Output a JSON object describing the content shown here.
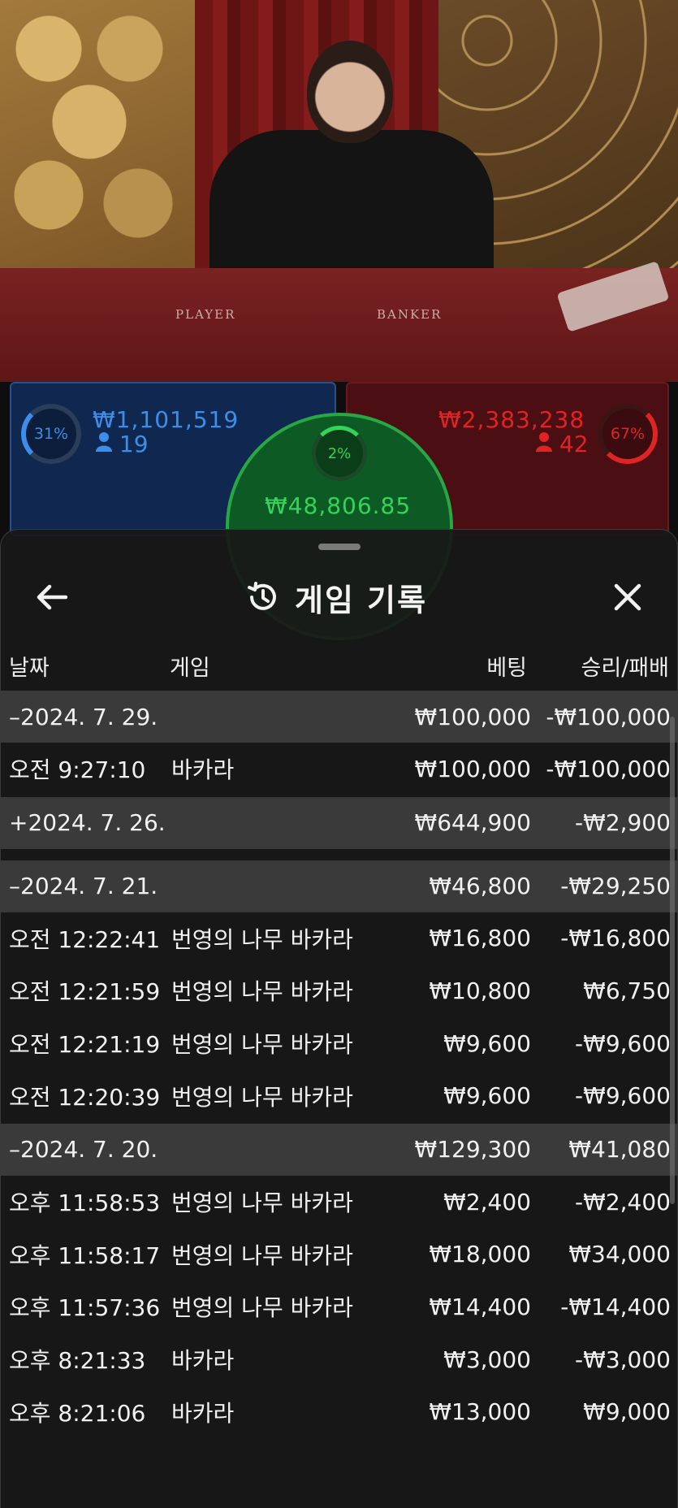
{
  "video": {
    "felt_player": "PLAYER",
    "felt_banker": "BANKER"
  },
  "bets": {
    "player": {
      "percent": "31%",
      "amount": "₩1,101,519",
      "count": "19",
      "color": "#3b8eea"
    },
    "banker": {
      "percent": "67%",
      "amount": "₩2,383,238",
      "count": "42",
      "color": "#e02323"
    },
    "tie": {
      "percent": "2%",
      "amount": "₩48,806.85",
      "color": "#33d45a"
    }
  },
  "sheet": {
    "title": "게임 기록",
    "back_icon": "arrow-left-icon",
    "history_icon": "history-icon",
    "close_icon": "close-icon",
    "columns": {
      "date": "날짜",
      "game": "게임",
      "bet": "베팅",
      "result": "승리/패배"
    },
    "rows": [
      {
        "type": "date",
        "label": "–2024. 7. 29.",
        "bet": "₩100,000",
        "result": "-₩100,000"
      },
      {
        "type": "item",
        "time": "오전 9:27:10",
        "game": "바카라",
        "bet": "₩100,000",
        "result": "-₩100,000"
      },
      {
        "type": "date",
        "label": "+2024. 7. 26.",
        "bet": "₩644,900",
        "result": "-₩2,900"
      },
      {
        "type": "gap"
      },
      {
        "type": "date",
        "label": "–2024. 7. 21.",
        "bet": "₩46,800",
        "result": "-₩29,250"
      },
      {
        "type": "item",
        "time": "오전 12:22:41",
        "game": "번영의 나무 바카라",
        "bet": "₩16,800",
        "result": "-₩16,800"
      },
      {
        "type": "item",
        "time": "오전 12:21:59",
        "game": "번영의 나무 바카라",
        "bet": "₩10,800",
        "result": "₩6,750"
      },
      {
        "type": "item",
        "time": "오전 12:21:19",
        "game": "번영의 나무 바카라",
        "bet": "₩9,600",
        "result": "-₩9,600"
      },
      {
        "type": "item",
        "time": "오전 12:20:39",
        "game": "번영의 나무 바카라",
        "bet": "₩9,600",
        "result": "-₩9,600"
      },
      {
        "type": "date",
        "label": "–2024. 7. 20.",
        "bet": "₩129,300",
        "result": "₩41,080"
      },
      {
        "type": "item",
        "time": "오후 11:58:53",
        "game": "번영의 나무 바카라",
        "bet": "₩2,400",
        "result": "-₩2,400"
      },
      {
        "type": "item",
        "time": "오후 11:58:17",
        "game": "번영의 나무 바카라",
        "bet": "₩18,000",
        "result": "₩34,000"
      },
      {
        "type": "item",
        "time": "오후 11:57:36",
        "game": "번영의 나무 바카라",
        "bet": "₩14,400",
        "result": "-₩14,400"
      },
      {
        "type": "item",
        "time": "오후 8:21:33",
        "game": "바카라",
        "bet": "₩3,000",
        "result": "-₩3,000"
      },
      {
        "type": "item",
        "time": "오후 8:21:06",
        "game": "바카라",
        "bet": "₩13,000",
        "result": "₩9,000"
      }
    ]
  }
}
